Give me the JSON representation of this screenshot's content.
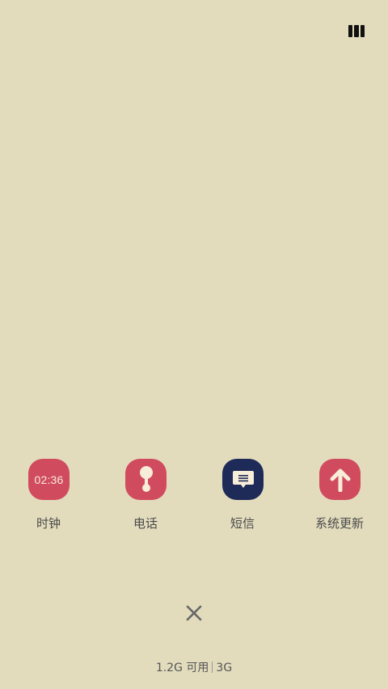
{
  "apps": [
    {
      "label": "时钟",
      "icon": "clock-icon",
      "color": "#d14b5f",
      "time": "02:36"
    },
    {
      "label": "电话",
      "icon": "phone-icon",
      "color": "#d14b5f"
    },
    {
      "label": "短信",
      "icon": "message-icon",
      "color": "#1e2a58"
    },
    {
      "label": "系统更新",
      "icon": "update-arrow-icon",
      "color": "#d14b5f"
    }
  ],
  "memory": {
    "available": "1.2G 可用",
    "total": "3G"
  },
  "controls": {
    "view_toggle_icon": "grid-view-icon",
    "close_icon": "close-icon"
  }
}
